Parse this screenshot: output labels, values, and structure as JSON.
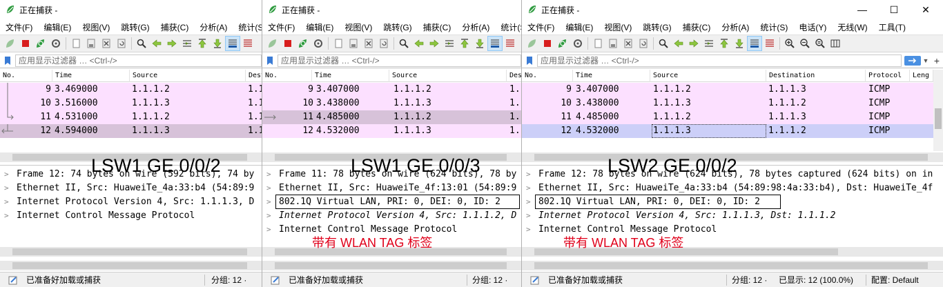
{
  "colors": {
    "icmp_row": "#fce0ff",
    "selected_row_inactive": "#d7c2d9",
    "selected_row_active": "#cccff8",
    "annotation": "#e0001a"
  },
  "windows": [
    {
      "title": "正在捕获 -",
      "menu": [
        "文件(F)",
        "编辑(E)",
        "视图(V)",
        "跳转(G)",
        "捕获(C)",
        "分析(A)",
        "统计(S)"
      ],
      "filter_placeholder": "应用显示过滤器 … <Ctrl-/>",
      "columns": [
        "No.",
        "Time",
        "Source",
        "Dest"
      ],
      "packets": [
        {
          "no": "9",
          "time": "3.469000",
          "source": "1.1.1.2",
          "dest": "1.1"
        },
        {
          "no": "10",
          "time": "3.516000",
          "source": "1.1.1.3",
          "dest": "1.1"
        },
        {
          "no": "11",
          "time": "4.531000",
          "source": "1.1.1.2",
          "dest": "1.1"
        },
        {
          "no": "12",
          "time": "4.594000",
          "source": "1.1.1.3",
          "dest": "1.1"
        }
      ],
      "overlay_label": "LSW1 GE 0/0/2",
      "details": [
        "Frame 12: 74 bytes on wire (592 bits), 74 by",
        "Ethernet II, Src: HuaweiTe_4a:33:b4 (54:89:9",
        "Internet Protocol Version 4, Src: 1.1.1.3, D",
        "Internet Control Message Protocol"
      ],
      "status": {
        "ready": "已准备好加载或捕获",
        "packets": "分组: 12 ·"
      }
    },
    {
      "title": "正在捕获 -",
      "menu": [
        "文件(F)",
        "编辑(E)",
        "视图(V)",
        "跳转(G)",
        "捕获(C)",
        "分析(A)",
        "统计(S)"
      ],
      "filter_placeholder": "应用显示过滤器 … <Ctrl-/>",
      "columns": [
        "No.",
        "Time",
        "Source",
        "Des"
      ],
      "packets": [
        {
          "no": "9",
          "time": "3.407000",
          "source": "1.1.1.2",
          "dest": "1."
        },
        {
          "no": "10",
          "time": "3.438000",
          "source": "1.1.1.3",
          "dest": "1."
        },
        {
          "no": "11",
          "time": "4.485000",
          "source": "1.1.1.2",
          "dest": "1."
        },
        {
          "no": "12",
          "time": "4.532000",
          "source": "1.1.1.3",
          "dest": "1."
        }
      ],
      "overlay_label": "LSW1 GE 0/0/3",
      "details": [
        "Frame 11: 78 bytes on wire (624 bits), 78 by",
        "Ethernet II, Src: HuaweiTe_4f:13:01 (54:89:9",
        "802.1Q Virtual LAN, PRI: 0, DEI: 0, ID: 2",
        "Internet Protocol Version 4, Src: 1.1.1.2, D",
        "Internet Control Message Protocol"
      ],
      "annotation": "带有 WLAN TAG 标签",
      "status": {
        "ready": "已准备好加载或捕获",
        "packets": "分组: 12 ·"
      }
    },
    {
      "title": "正在捕获 -",
      "menu": [
        "文件(F)",
        "编辑(E)",
        "视图(V)",
        "跳转(G)",
        "捕获(C)",
        "分析(A)",
        "统计(S)",
        "电话(Y)",
        "无线(W)",
        "工具(T)"
      ],
      "filter_placeholder": "应用显示过滤器 … <Ctrl-/>",
      "columns": [
        "No.",
        "Time",
        "Source",
        "Destination",
        "Protocol",
        "Leng"
      ],
      "packets": [
        {
          "no": "9",
          "time": "3.407000",
          "source": "1.1.1.2",
          "dest": "1.1.1.3",
          "protocol": "ICMP"
        },
        {
          "no": "10",
          "time": "3.438000",
          "source": "1.1.1.3",
          "dest": "1.1.1.2",
          "protocol": "ICMP"
        },
        {
          "no": "11",
          "time": "4.485000",
          "source": "1.1.1.2",
          "dest": "1.1.1.3",
          "protocol": "ICMP"
        },
        {
          "no": "12",
          "time": "4.532000",
          "source": "1.1.1.3",
          "dest": "1.1.1.2",
          "protocol": "ICMP"
        }
      ],
      "overlay_label": "LSW2 GE 0/0/2",
      "details": [
        "Frame 12: 78 bytes on wire (624 bits), 78 bytes captured (624 bits) on in",
        "Ethernet II, Src: HuaweiTe_4a:33:b4 (54:89:98:4a:33:b4), Dst: HuaweiTe_4f",
        "802.1Q Virtual LAN, PRI: 0, DEI: 0, ID: 2",
        "Internet Protocol Version 4, Src: 1.1.1.3, Dst: 1.1.1.2",
        "Internet Control Message Protocol"
      ],
      "annotation": "带有 WLAN TAG 标签",
      "status": {
        "ready": "已准备好加载或捕获",
        "packets": "分组: 12 ·",
        "displayed": "已显示: 12 (100.0%)",
        "profile": "配置: Default"
      },
      "window_controls": {
        "minimize": "—",
        "maximize": "☐",
        "close": "✕"
      }
    }
  ]
}
